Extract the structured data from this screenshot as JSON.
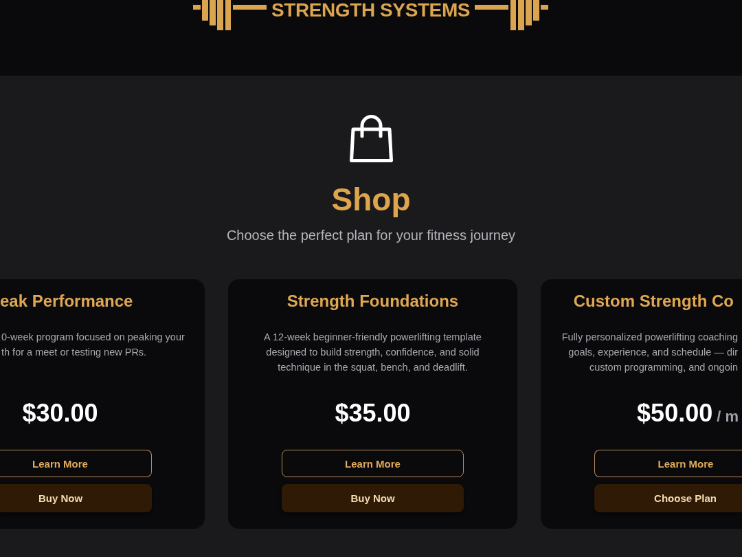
{
  "header": {
    "logo_text": "STRENGTH SYSTEMS"
  },
  "shop": {
    "title": "Shop",
    "subtitle": "Choose the perfect plan for your fitness journey"
  },
  "plans": [
    {
      "title": "eak Performance",
      "description": [
        "0-week program focused on peaking your",
        "th for a meet or testing new PRs."
      ],
      "price": "$30.00",
      "buttons": [
        {
          "label": "Learn More",
          "kind": "details"
        },
        {
          "label": "Buy Now",
          "kind": "purchase"
        }
      ]
    },
    {
      "title": "Strength Foundations",
      "description": [
        "A 12-week beginner-friendly powerlifting template",
        "designed to build strength, confidence, and solid",
        "technique in the squat, bench, and deadlift."
      ],
      "price": "$35.00",
      "buttons": [
        {
          "label": "Learn More",
          "kind": "details"
        },
        {
          "label": "Buy Now",
          "kind": "purchase"
        }
      ]
    },
    {
      "title": "Custom Strength Co",
      "description": [
        "Fully personalized powerlifting coaching",
        "goals, experience, and schedule — dir",
        "custom programming, and ongoin"
      ],
      "price": "$50.00",
      "period": "/ m",
      "buttons": [
        {
          "label": "Learn More",
          "kind": "details"
        },
        {
          "label": "Choose Plan",
          "kind": "purchase"
        }
      ]
    }
  ]
}
